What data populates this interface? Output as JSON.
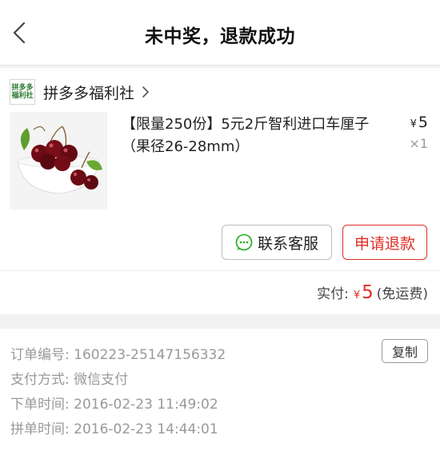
{
  "header": {
    "title": "未中奖，退款成功"
  },
  "shop": {
    "logo_line1": "拼多多",
    "logo_line2": "福利社",
    "name": "拼多多福利社"
  },
  "product": {
    "title": "【限量250份】5元2斤智利进口车厘子（果径26-28mm）",
    "price_symbol": "¥",
    "price": "5",
    "quantity": "×1"
  },
  "actions": {
    "contact_label": "联系客服",
    "refund_label": "申请退款"
  },
  "payment": {
    "label": "实付:",
    "symbol": "¥",
    "amount": "5",
    "note": "(免运费)"
  },
  "order": {
    "copy_label": "复制",
    "rows": [
      {
        "label": "订单编号:",
        "value": "160223-25147156332"
      },
      {
        "label": "支付方式:",
        "value": "微信支付"
      },
      {
        "label": "下单时间:",
        "value": "2016-02-23 11:49:02"
      },
      {
        "label": "拼单时间:",
        "value": "2016-02-23 14:44:01"
      }
    ]
  },
  "colors": {
    "accent": "#e02e24",
    "wechat_green": "#1aad19",
    "background": "#f2f2f2"
  },
  "icons": [
    "back-arrow-icon",
    "chevron-right-icon",
    "chat-bubble-icon"
  ]
}
